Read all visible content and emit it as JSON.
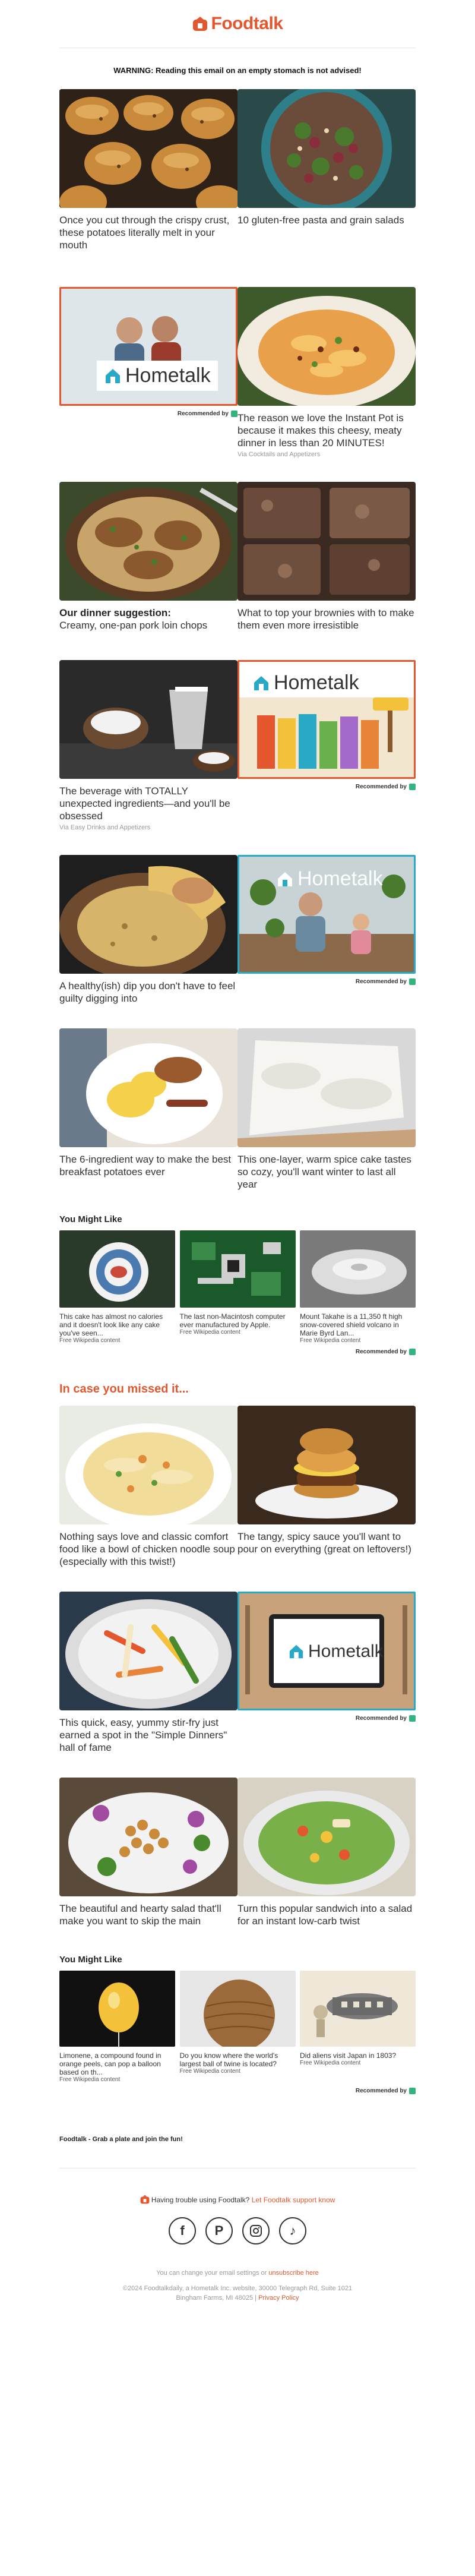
{
  "brand": {
    "name": "Foodtalk",
    "accent": "#e4572e"
  },
  "warning": "WARNING: Reading this email on an empty stomach is not advised!",
  "recommended_label": "Recommended by",
  "hometalk_logo": "Hometalk",
  "section1": [
    {
      "caption": "Once you cut through the crispy crust, these potatoes literally melt in your mouth",
      "image": "roasted-potatoes"
    },
    {
      "caption": "10 gluten-free pasta and grain salads",
      "image": "grain-salad"
    }
  ],
  "section2": [
    {
      "image": "hometalk-ad-couple"
    },
    {
      "caption": "The reason we love the Instant Pot is because it makes this cheesy, meaty dinner in less than 20 MINUTES!",
      "via": "Via Cocktails and Appetizers",
      "image": "cheesy-pasta"
    }
  ],
  "section3": [
    {
      "bold": "Our dinner suggestion:",
      "caption": "Creamy, one-pan pork loin chops",
      "image": "pork-chops"
    },
    {
      "caption": "What to top your brownies with to make them even more irresistible",
      "image": "brownies"
    }
  ],
  "section4": [
    {
      "caption": "The beverage with TOTALLY unexpected ingredients—and you'll be obsessed",
      "via": "Via Easy Drinks and Appetizers",
      "image": "coconut-drink"
    },
    {
      "image": "hometalk-ad-paint"
    }
  ],
  "section5": [
    {
      "caption": "A healthy(ish) dip you don't have to feel guilty digging into",
      "image": "dip"
    },
    {
      "image": "hometalk-ad-plants"
    }
  ],
  "section6": [
    {
      "caption": "The 6-ingredient way to make the best breakfast potatoes ever",
      "image": "breakfast-plate"
    },
    {
      "caption": "This one-layer, warm spice cake tastes so cozy, you'll want winter to last all year",
      "image": "spice-cake"
    }
  ],
  "you_might_like_1": {
    "title": "You Might Like",
    "items": [
      {
        "caption": "This cake has almost no calories and it doesn't look like any cake you've seen...",
        "source": "Free Wikipedia content"
      },
      {
        "caption": "The last non-Macintosh computer ever manufactured by Apple.",
        "source": "Free Wikipedia content"
      },
      {
        "caption": "Mount Takahe is a 11,350 ft high snow-covered shield volcano in Marie Byrd Lan...",
        "source": "Free Wikipedia content"
      }
    ]
  },
  "missed_title": "In case you missed it...",
  "section7": [
    {
      "caption": "Nothing says love and classic comfort food like a bowl of chicken noodle soup (especially with this twist!)",
      "image": "chicken-soup"
    },
    {
      "caption": "The tangy, spicy sauce you'll want to pour on everything (great on leftovers!)",
      "image": "sandwich-stack"
    }
  ],
  "section8": [
    {
      "caption": "This quick, easy, yummy stir-fry just earned a spot in the \"Simple Dinners\" hall of fame",
      "image": "stir-fry"
    },
    {
      "image": "hometalk-ad-tablet"
    }
  ],
  "section9": [
    {
      "caption": "The beautiful and hearty salad that'll make you want to skip the main",
      "image": "chickpea-salad"
    },
    {
      "caption": "Turn this popular sandwich into a salad for an instant low-carb twist",
      "image": "sandwich-salad"
    }
  ],
  "you_might_like_2": {
    "title": "You Might Like",
    "items": [
      {
        "caption": "Limonene, a compound found in orange peels, can pop a balloon based on th...",
        "source": "Free Wikipedia content"
      },
      {
        "caption": "Do you know where the world's largest ball of twine is located?",
        "source": "Free Wikipedia content"
      },
      {
        "caption": "Did aliens visit Japan in 1803?",
        "source": "Free Wikipedia content"
      }
    ]
  },
  "footer": {
    "tagline": "Foodtalk - Grab a plate and join the fun!",
    "trouble": "Having trouble using Foodtalk?",
    "trouble_link": "Let Foodtalk support know",
    "socials": [
      "facebook-icon",
      "pinterest-icon",
      "instagram-icon",
      "tiktok-icon"
    ],
    "settings_text": "You can change your email settings or",
    "unsubscribe": "unsubscribe here",
    "copyright": "©2024 Foodtalkdaily, a Hometalk Inc. website, 30000 Telegraph Rd, Suite 1021",
    "address": "Bingham Farms, MI 48025",
    "sep": "|",
    "privacy": "Privacy Policy"
  }
}
